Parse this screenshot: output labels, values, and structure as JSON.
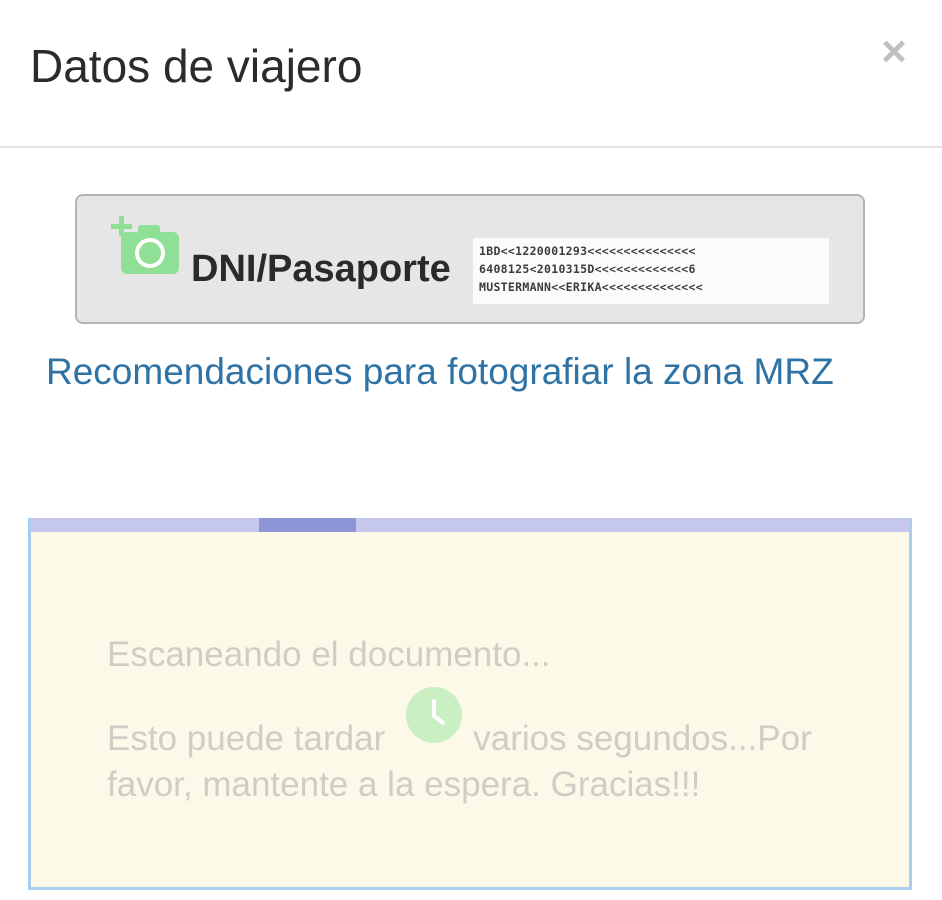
{
  "modal": {
    "title": "Datos de viajero",
    "close_label": "×"
  },
  "scan_button": {
    "label": "DNI/Pasaporte",
    "icon": "camera-add-icon",
    "mrz_sample_lines": [
      "1BD<<1220001293<<<<<<<<<<<<<<<",
      "6408125<2010315D<<<<<<<<<<<<<6",
      "MUSTERMANN<<ERIKA<<<<<<<<<<<<<<"
    ]
  },
  "mrz_link": {
    "label": "Recomendaciones para fotografiar la zona MRZ"
  },
  "scan_panel": {
    "status": "Escaneando el documento...",
    "message_line_1a": "Esto puede tardar",
    "message_line_1b": "varios segundos...Por",
    "message_line_2": "favor, mantente a la espera. Gracias!!!",
    "icon": "clock-icon",
    "progress": {
      "start_fraction": 0.26,
      "end_fraction": 0.37
    }
  },
  "colors": {
    "link": "#2f73a6",
    "camera_icon": "#8fdf96",
    "panel_background": "#fdf9e9",
    "panel_border": "#a9cdf1",
    "progress_track": "#c5c8ec",
    "progress_fill": "#8d95d6",
    "muted_text": "#cfcdc4"
  }
}
